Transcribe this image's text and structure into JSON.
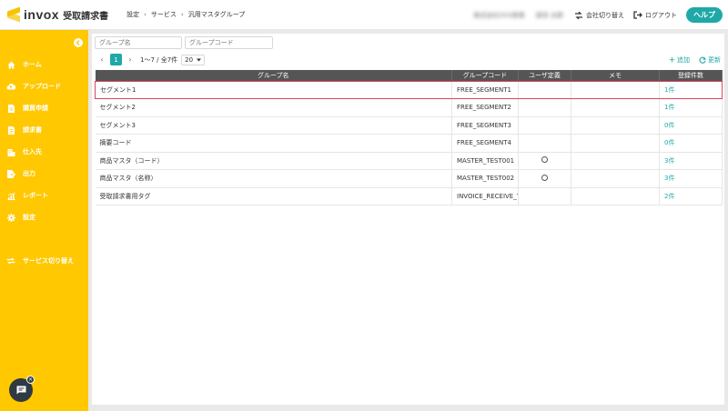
{
  "header": {
    "logo_text": "invox",
    "logo_sub": "受取請求書",
    "breadcrumb": [
      "設定",
      "サービス",
      "汎用マスタグループ"
    ],
    "user_company": "株式会社XXX商事",
    "user_name": "請求 太郎",
    "switch_company_label": "会社切り替え",
    "logout_label": "ログアウト",
    "help_label": "ヘルプ"
  },
  "sidebar": {
    "items": [
      {
        "label": "ホーム",
        "icon": "home-icon"
      },
      {
        "label": "アップロード",
        "icon": "upload-icon"
      },
      {
        "label": "購買申請",
        "icon": "document-icon"
      },
      {
        "label": "請求書",
        "icon": "invoice-icon"
      },
      {
        "label": "仕入先",
        "icon": "building-icon"
      },
      {
        "label": "出力",
        "icon": "export-icon"
      },
      {
        "label": "レポート",
        "icon": "chart-icon"
      },
      {
        "label": "設定",
        "icon": "gear-icon"
      },
      {
        "label": "サービス切り替え",
        "icon": "switch-icon"
      }
    ]
  },
  "filters": {
    "group_name_placeholder": "グループ名",
    "group_code_placeholder": "グループコード"
  },
  "pager": {
    "prev": "‹",
    "current_page": "1",
    "next": "›",
    "count": "1〜7 / 全7件",
    "page_size": "20"
  },
  "actions": {
    "add_label": "追加",
    "refresh_label": "更新"
  },
  "table": {
    "headers": [
      "グループ名",
      "グループコード",
      "ユーザ定義",
      "メモ",
      "登録件数"
    ],
    "rows": [
      {
        "name": "セグメント1",
        "code": "FREE_SEGMENT1",
        "user_defined": false,
        "memo": "",
        "count": "1件",
        "selected": true
      },
      {
        "name": "セグメント2",
        "code": "FREE_SEGMENT2",
        "user_defined": false,
        "memo": "",
        "count": "1件"
      },
      {
        "name": "セグメント3",
        "code": "FREE_SEGMENT3",
        "user_defined": false,
        "memo": "",
        "count": "0件"
      },
      {
        "name": "摘要コード",
        "code": "FREE_SEGMENT4",
        "user_defined": false,
        "memo": "",
        "count": "0件"
      },
      {
        "name": "商品マスタ（コード）",
        "code": "MASTER_TEST001",
        "user_defined": true,
        "memo": "",
        "count": "3件"
      },
      {
        "name": "商品マスタ（名称）",
        "code": "MASTER_TEST002",
        "user_defined": true,
        "memo": "",
        "count": "3件"
      },
      {
        "name": "受取請求書用タグ",
        "code": "INVOICE_RECEIVE_TAG",
        "user_defined": false,
        "memo": "",
        "count": "2件"
      }
    ]
  },
  "colors": {
    "accent": "#1fa8a8",
    "sidebar": "#ffc800",
    "selection": "#d9475f",
    "header_row": "#555555"
  }
}
